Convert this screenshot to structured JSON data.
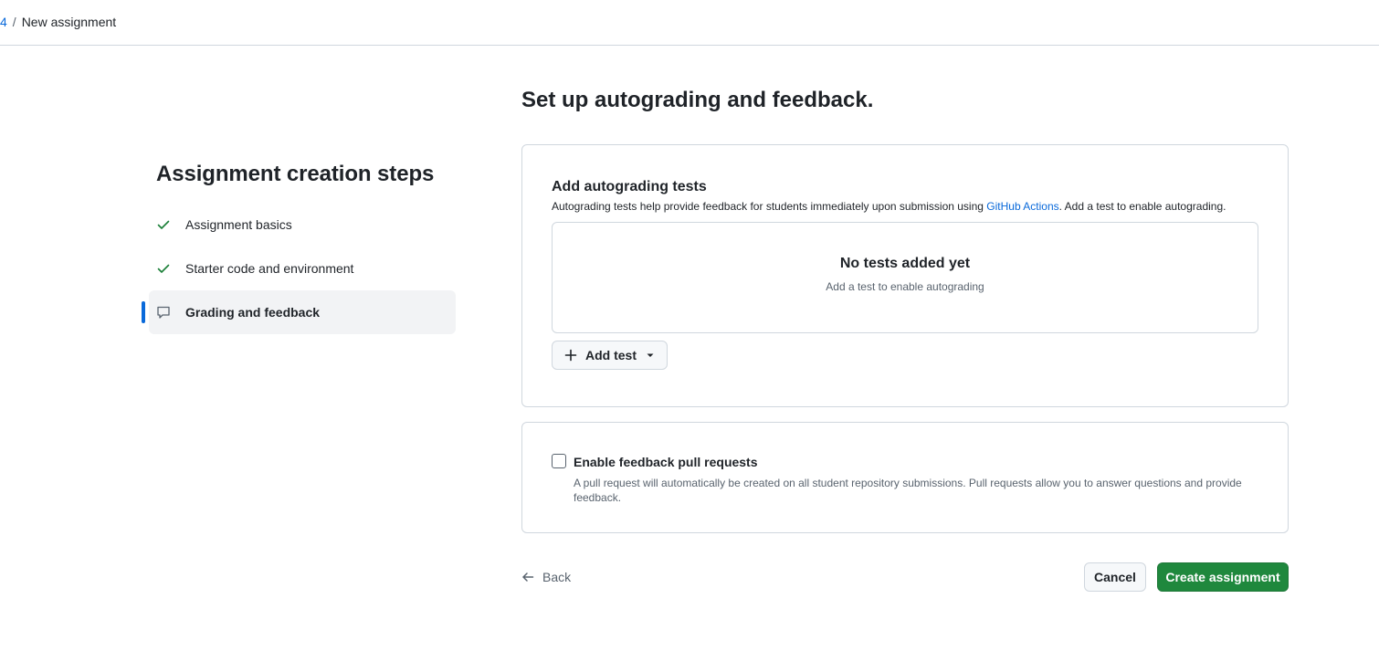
{
  "breadcrumb": {
    "parent": "4",
    "separator": "/",
    "current": "New assignment"
  },
  "sidebar": {
    "title": "Assignment creation steps",
    "steps": [
      {
        "label": "Assignment basics",
        "icon": "check-icon",
        "status": "complete"
      },
      {
        "label": "Starter code and environment",
        "icon": "check-icon",
        "status": "complete"
      },
      {
        "label": "Grading and feedback",
        "icon": "comment-icon",
        "status": "current"
      }
    ]
  },
  "main": {
    "title": "Set up autograding and feedback.",
    "tests": {
      "heading": "Add autograding tests",
      "description_before": "Autograding tests help provide feedback for students immediately upon submission using ",
      "description_link": "GitHub Actions",
      "description_after": ". Add a test to enable autograding.",
      "empty_title": "No tests added yet",
      "empty_subtitle": "Add a test to enable autograding",
      "add_button": "Add test"
    },
    "feedback": {
      "checkbox_label": "Enable feedback pull requests",
      "checked": false,
      "description": "A pull request will automatically be created on all student repository submissions. Pull requests allow you to answer questions and provide feedback."
    }
  },
  "footer": {
    "back_label": "Back",
    "cancel_label": "Cancel",
    "create_label": "Create assignment"
  },
  "colors": {
    "accent": "#0969da",
    "success": "#1f883d",
    "check": "#1a7f37"
  }
}
